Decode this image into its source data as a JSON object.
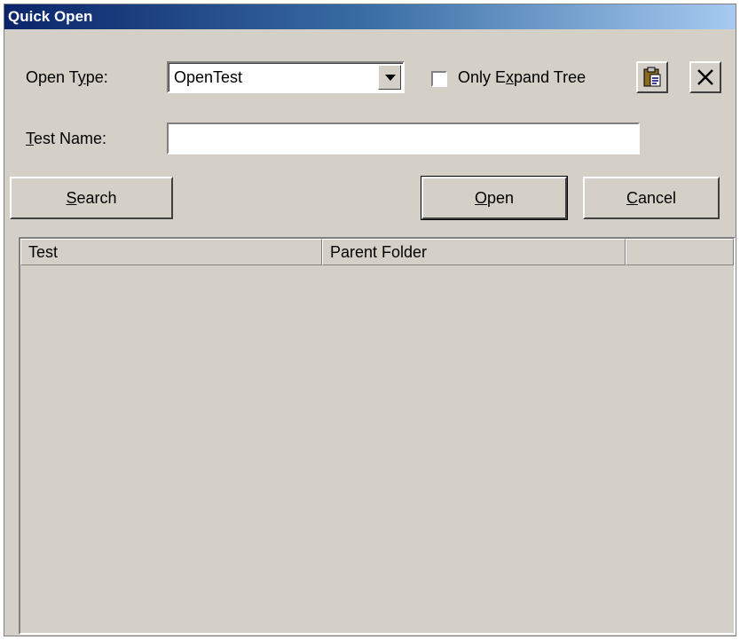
{
  "window": {
    "title": "Quick Open"
  },
  "open_type": {
    "label_pre": "Open T",
    "label_u": "y",
    "label_post": "pe:",
    "value": "OpenTest"
  },
  "only_expand_tree": {
    "label_pre": "Only E",
    "label_u": "x",
    "label_post": "pand Tree",
    "checked": false
  },
  "test_name": {
    "label_u": "T",
    "label_post": "est Name:",
    "value": ""
  },
  "buttons": {
    "search_u": "S",
    "search_post": "earch",
    "open_u": "O",
    "open_post": "pen",
    "cancel_u": "C",
    "cancel_post": "ancel"
  },
  "table": {
    "columns": [
      "Test",
      "Parent Folder",
      ""
    ]
  },
  "icons": {
    "paste": "clipboard-icon",
    "close": "close-x-icon"
  }
}
